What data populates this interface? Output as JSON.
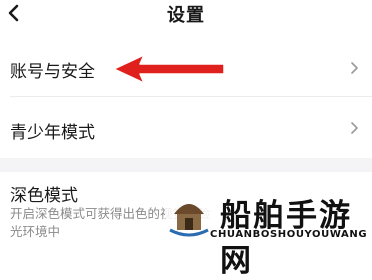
{
  "header": {
    "title": "设置",
    "back_icon": "chevron-left-icon"
  },
  "settings": {
    "account_security": {
      "label": "账号与安全"
    },
    "youth_mode": {
      "label": "青少年模式"
    },
    "dark_mode": {
      "label": "深色模式",
      "description_line1": "开启深色模式可获得出色的视觉体验",
      "description_line2": "光环境中"
    }
  },
  "annotation": {
    "arrow_color": "#e0201c"
  },
  "watermark": {
    "text": "船舶手游网",
    "subtext": "CHUANBOSHOUYOUWANG"
  }
}
